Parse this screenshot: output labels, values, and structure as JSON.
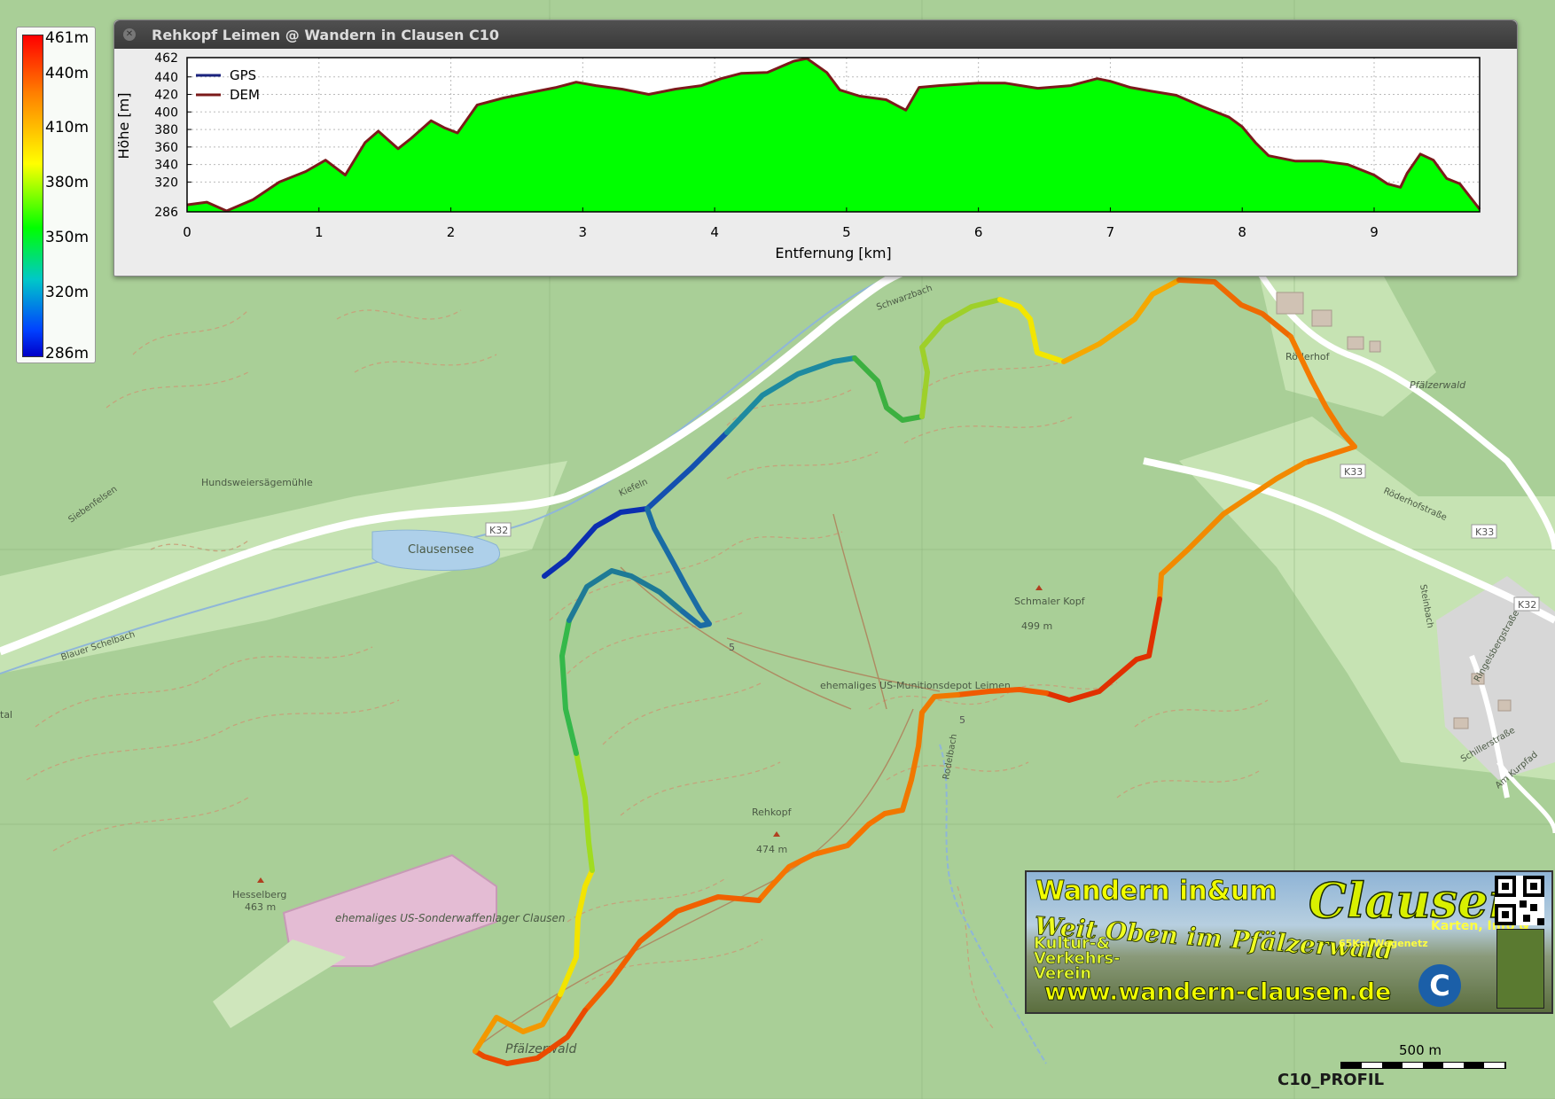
{
  "window": {
    "title": "Rehkopf Leimen @ Wandern in Clausen C10",
    "close_icon": "close-icon"
  },
  "legend": {
    "type": "elevation-color-scale",
    "ticks": [
      "461m",
      "440m",
      "410m",
      "380m",
      "350m",
      "320m",
      "286m"
    ],
    "min": 286,
    "max": 461
  },
  "chart_data": {
    "type": "area",
    "title": "",
    "xlabel": "Entfernung [km]",
    "ylabel": "Höhe [m]",
    "xlim": [
      0,
      9.8
    ],
    "ylim": [
      286,
      462
    ],
    "x_ticks": [
      "0",
      "1",
      "2",
      "3",
      "4",
      "5",
      "6",
      "7",
      "8",
      "9"
    ],
    "y_ticks": [
      "462",
      "440",
      "420",
      "400",
      "380",
      "360",
      "340",
      "320",
      "286"
    ],
    "grid": true,
    "legend_position": "top-left",
    "fill_color": "#00ff00",
    "series": [
      {
        "name": "GPS",
        "color": "#1a237e"
      },
      {
        "name": "DEM",
        "color": "#7b1a1a",
        "x": [
          0,
          0.15,
          0.3,
          0.5,
          0.7,
          0.9,
          1.05,
          1.2,
          1.35,
          1.45,
          1.6,
          1.7,
          1.85,
          1.95,
          2.05,
          2.2,
          2.4,
          2.6,
          2.8,
          2.95,
          3.1,
          3.3,
          3.5,
          3.7,
          3.9,
          4.05,
          4.2,
          4.4,
          4.6,
          4.7,
          4.85,
          4.95,
          5.1,
          5.3,
          5.45,
          5.55,
          5.7,
          6.0,
          6.2,
          6.45,
          6.7,
          6.9,
          7.0,
          7.15,
          7.3,
          7.5,
          7.7,
          7.9,
          8.0,
          8.1,
          8.2,
          8.4,
          8.6,
          8.8,
          9.0,
          9.1,
          9.2,
          9.25,
          9.35,
          9.45,
          9.55,
          9.65,
          9.8
        ],
        "y": [
          294,
          297,
          287,
          300,
          320,
          332,
          345,
          328,
          365,
          378,
          358,
          370,
          390,
          382,
          376,
          408,
          416,
          422,
          428,
          434,
          430,
          426,
          420,
          426,
          430,
          438,
          444,
          445,
          458,
          461,
          445,
          425,
          418,
          414,
          402,
          428,
          430,
          433,
          433,
          427,
          430,
          438,
          435,
          428,
          424,
          419,
          406,
          394,
          383,
          365,
          350,
          344,
          344,
          340,
          328,
          318,
          314,
          330,
          352,
          345,
          324,
          318,
          289
        ]
      }
    ]
  },
  "map": {
    "places": [
      {
        "name": "Hundsweiersägemühle"
      },
      {
        "name": "Clausensee"
      },
      {
        "name": "Röderhof"
      },
      {
        "name": "Pfälzerwald"
      },
      {
        "name": "Röderhofstraße"
      },
      {
        "name": "Schmaler Kopf",
        "elevation": "499 m"
      },
      {
        "name": "ehemaliges US-Munitionsdepot Leimen"
      },
      {
        "name": "Rehkopf",
        "elevation": "474 m"
      },
      {
        "name": "Hesselberg",
        "elevation": "463 m"
      },
      {
        "name": "ehemaliges US-Sonderwaffenlager Clausen"
      },
      {
        "name": "Pfälzerwald"
      },
      {
        "name": "Schwarzbach"
      },
      {
        "name": "Rodelbach"
      },
      {
        "name": "Blauer Schelbach"
      },
      {
        "name": "Siebenfelsen"
      },
      {
        "name": "Kiefeln"
      },
      {
        "name": "Steinbach"
      },
      {
        "name": "Ringelsbergstraße"
      },
      {
        "name": "Schillerstraße"
      },
      {
        "name": "Am Kurpfad"
      },
      {
        "name": "tal"
      }
    ],
    "roads": [
      "K32",
      "K33",
      "K33",
      "K32",
      "5",
      "5"
    ]
  },
  "banner": {
    "line1": "Wandern in&um",
    "brand": "Clausen",
    "slogan": "Weit Oben im Pfälzerwald",
    "club": "Kultur-& Verkehrs- Verein",
    "network": "65Km Wegenetz",
    "side": "Karten, Info &",
    "url": "www.wandern-clausen.de",
    "logo_letter": "C"
  },
  "scale": {
    "label": "500 m"
  },
  "caption": "C10_PROFIL"
}
